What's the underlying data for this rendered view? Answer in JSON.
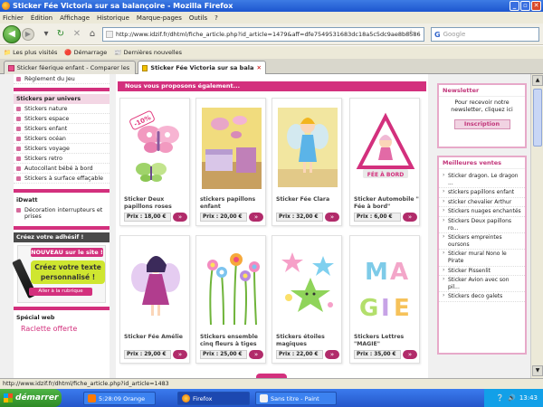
{
  "window": {
    "title": "Sticker Fée Victoria sur sa balançoire - Mozilla Firefox",
    "buttons": [
      "_",
      "▫",
      "✕"
    ]
  },
  "menu": [
    "Fichier",
    "Édition",
    "Affichage",
    "Historique",
    "Marque-pages",
    "Outils",
    "?"
  ],
  "nav": {
    "back": "◀",
    "forward": "▶",
    "reload": "↻",
    "stop": "✕",
    "home": "⌂",
    "url": "http://www.idzif.fr/dhtml/fiche_article.php?id_article=1479&aff=dfe7549531683dc18a5c5dc9ae8b8586",
    "search_engine": "G",
    "search_placeholder": "Google",
    "star": "☆"
  },
  "bookmarks": [
    "Les plus visités",
    "Démarrage",
    "Dernières nouvelles"
  ],
  "tabs": [
    {
      "label": "Sticker féerique enfant - Comparer les ...",
      "active": false
    },
    {
      "label": "Sticker Fée Victoria sur sa balanç...",
      "active": true
    }
  ],
  "left": {
    "top_item": "Règlement du Jeu",
    "univers_title": "Stickers par univers",
    "univers": [
      "Stickers nature",
      "Stickers espace",
      "Stickers enfant",
      "Stickers océan",
      "Stickers voyage",
      "Stickers retro",
      "Autocollant bébé à bord",
      "Stickers à surface effaçable"
    ],
    "idwatt_title": "iDwatt",
    "idwatt_item": "Décoration interrupteurs et prises",
    "adhesif_title": "Créez votre adhésif !",
    "ad_new": "NOUVEAU sur le site !",
    "ad_main": "Créez votre texte personnalisé !",
    "ad_link": "Aller à la rubrique",
    "special_title": "Spécial web",
    "brand": "Raclette offerte"
  },
  "main": {
    "section_title": "Nous vous proposons également...",
    "products": [
      {
        "name": "Sticker Deux papillons roses",
        "price": "Prix : 18,00 €"
      },
      {
        "name": "stickers papillons enfant",
        "price": "Prix : 20,00 €"
      },
      {
        "name": "Sticker Fée Clara",
        "price": "Prix : 32,00 €"
      },
      {
        "name": "Sticker Automobile \" Fée à bord\"",
        "price": "Prix : 6,00 €"
      },
      {
        "name": "Sticker Fée Amélie",
        "price": "Prix : 29,00 €"
      },
      {
        "name": "Stickers ensemble cinq fleurs à tiges",
        "price": "Prix : 25,00 €"
      },
      {
        "name": "Stickers étoiles magiques",
        "price": "Prix : 22,00 €"
      },
      {
        "name": "Stickers Lettres \"MAGIE\"",
        "price": "Prix : 35,00 €"
      }
    ],
    "price_button": "»",
    "badge_text": "-10%",
    "fee_a_bord": "FÉE À BORD",
    "magie_letters": "MAGIE"
  },
  "right": {
    "newsletter_title": "Newsletter",
    "newsletter_text": "Pour recevoir notre newsletter, cliquez ici",
    "inscription": "Inscription",
    "best_title": "Meilleures ventes",
    "best": [
      "Sticker dragon. Le dragon ...",
      "stickers papillons enfant",
      "sticker chevalier Arthur",
      "Stickers nuages enchantés",
      "Stickers Deux papillons ro...",
      "Stickers empreintes oursons",
      "Sticker mural Nono le Pirate",
      "Sticker Pissenlit",
      "Sticker Avion avec son pil...",
      "Stickers deco galets"
    ]
  },
  "status": "http://www.idzif.fr/dhtml/fiche_article.php?id_article=1483",
  "taskbar": {
    "start": "démarrer",
    "items": [
      "5:28:09 Orange",
      "Firefox",
      "Sans titre - Paint"
    ],
    "clock": "13:43"
  }
}
